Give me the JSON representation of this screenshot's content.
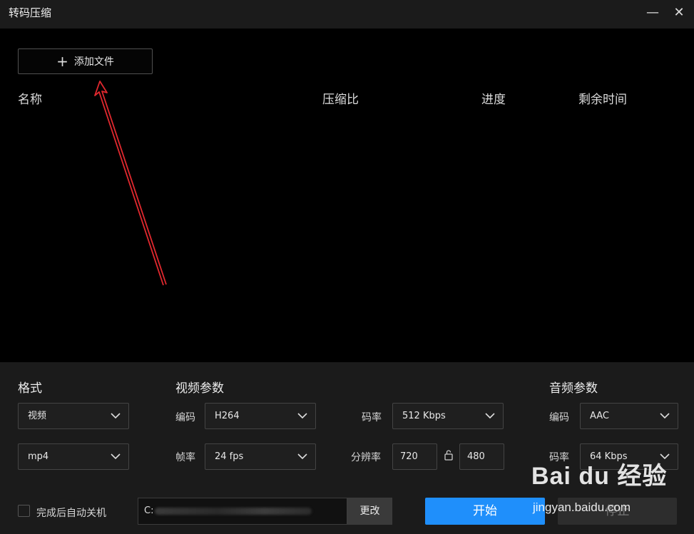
{
  "window": {
    "title": "转码压缩",
    "minimize_glyph": "—",
    "close_glyph": "✕"
  },
  "toolbar": {
    "add_file_label": "添加文件",
    "add_icon": "plus-icon"
  },
  "file_list": {
    "columns": [
      "名称",
      "压缩比",
      "进度",
      "剩余时间"
    ]
  },
  "format": {
    "section_title": "格式",
    "type_value": "视频",
    "container_value": "mp4"
  },
  "video_params": {
    "section_title": "视频参数",
    "codec_label": "编码",
    "codec_value": "H264",
    "bitrate_label": "码率",
    "bitrate_value": "512 Kbps",
    "framerate_label": "帧率",
    "framerate_value": "24 fps",
    "resolution_label": "分辨率",
    "width_value": "720",
    "height_value": "480"
  },
  "audio_params": {
    "section_title": "音频参数",
    "codec_label": "编码",
    "codec_value": "AAC",
    "bitrate_label": "码率",
    "bitrate_value": "64 Kbps"
  },
  "footer": {
    "auto_shutdown_label": "完成后自动关机",
    "output_path_prefix": "C:",
    "change_label": "更改",
    "start_label": "开始",
    "stop_label": "停止"
  },
  "watermark": {
    "main": "Bai du 经验",
    "sub": "jingyan.baidu.com"
  },
  "colors": {
    "accent": "#1f8ffb",
    "annotation_arrow": "#e0282e",
    "panel": "#1b1b1b",
    "background": "#000000"
  }
}
